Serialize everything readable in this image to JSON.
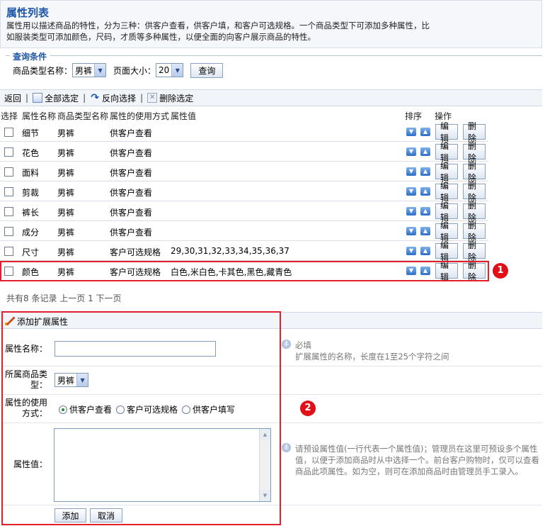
{
  "header": {
    "title": "属性列表",
    "desc": "属性用以描述商品的特性，分为三种：供客户查看，供客户填，和客户可选规格。一个商品类型下可添加多种属性，比如服装类型可添加颜色，尺码，才质等多种属性，以便全面的向客户展示商品的特性。"
  },
  "query": {
    "legend": "查询条件",
    "type_label": "商品类型名称：",
    "type_value": "男裤",
    "pagesize_label": "页面大小：",
    "pagesize_value": "20",
    "search_btn": "查询"
  },
  "toolbar": {
    "back": "返回",
    "select_all": "全部选定",
    "invert": "反向选择",
    "delete_selected": "删除选定"
  },
  "columns": {
    "select": "选择",
    "name": "属性名称",
    "type": "商品类型名称",
    "usage": "属性的使用方式",
    "values": "属性值",
    "sort": "排序",
    "ops": "操作"
  },
  "rows": [
    {
      "name": "细节",
      "type": "男裤",
      "usage": "供客户查看",
      "values": ""
    },
    {
      "name": "花色",
      "type": "男裤",
      "usage": "供客户查看",
      "values": ""
    },
    {
      "name": "面料",
      "type": "男裤",
      "usage": "供客户查看",
      "values": ""
    },
    {
      "name": "剪裁",
      "type": "男裤",
      "usage": "供客户查看",
      "values": ""
    },
    {
      "name": "裤长",
      "type": "男裤",
      "usage": "供客户查看",
      "values": ""
    },
    {
      "name": "成分",
      "type": "男裤",
      "usage": "供客户查看",
      "values": ""
    },
    {
      "name": "尺寸",
      "type": "男裤",
      "usage": "客户可选规格",
      "values": "29,30,31,32,33,34,35,36,37"
    },
    {
      "name": "颜色",
      "type": "男裤",
      "usage": "客户可选规格",
      "values": "白色,米白色,卡其色,黑色,藏青色"
    }
  ],
  "row_buttons": {
    "edit": "编辑",
    "delete": "删除"
  },
  "pager": "共有8 条记录 上一页 1 下一页",
  "badges": {
    "one": "1",
    "two": "2"
  },
  "add_panel": {
    "title": "添加扩展属性",
    "name_label": "属性名称：",
    "name_value": "",
    "name_hint_title": "必填",
    "name_hint": "扩展属性的名称，长度在1至25个字符之间",
    "type_label": "所属商品类型：",
    "type_value": "男裤",
    "usage_label": "属性的使用方式：",
    "usage_options": [
      "供客户查看",
      "客户可选规格",
      "供客户填写"
    ],
    "values_label": "属性值：",
    "values_hint": "请预设属性值(一行代表一个属性值)；管理员在这里可预设多个属性值，以便于添加商品时从中选择一个。前台客户购物时，仅可以查看商品此项属性。如为空，则可在添加商品时由管理员手工录入。",
    "add_btn": "添加",
    "cancel_btn": "取消"
  }
}
